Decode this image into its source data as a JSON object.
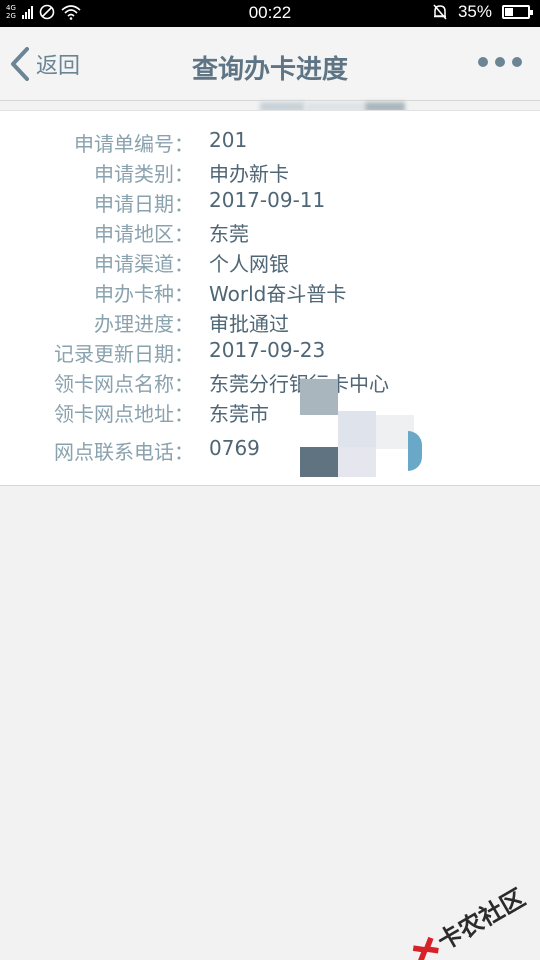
{
  "status_bar": {
    "network_top": "4G",
    "network_bottom": "2G",
    "time": "00:22",
    "battery_pct": "35%"
  },
  "nav": {
    "back_label": "返回",
    "title": "查询办卡进度",
    "more_icon": "more-dots-icon"
  },
  "details": [
    {
      "label": "申请单编号：",
      "value": "201"
    },
    {
      "label": "申请类别：",
      "value": "申办新卡"
    },
    {
      "label": "申请日期：",
      "value": "2017-09-11"
    },
    {
      "label": "申请地区：",
      "value": "东莞"
    },
    {
      "label": "申请渠道：",
      "value": "个人网银"
    },
    {
      "label": "申办卡种：",
      "value": "World奋斗普卡"
    },
    {
      "label": "办理进度：",
      "value": "审批通过"
    },
    {
      "label": "记录更新日期：",
      "value": "2017-09-23"
    },
    {
      "label": "领卡网点名称：",
      "value": "东莞分行银行卡中心"
    },
    {
      "label": "领卡网点地址：",
      "value": "东莞市"
    },
    {
      "label": "网点联系电话：",
      "value": "0769"
    }
  ],
  "watermark": {
    "text": "卡农社区"
  },
  "colors": {
    "accent": "#6b8595",
    "label": "#8aa2ae",
    "value": "#4f6675",
    "background": "#f2f2f2"
  }
}
